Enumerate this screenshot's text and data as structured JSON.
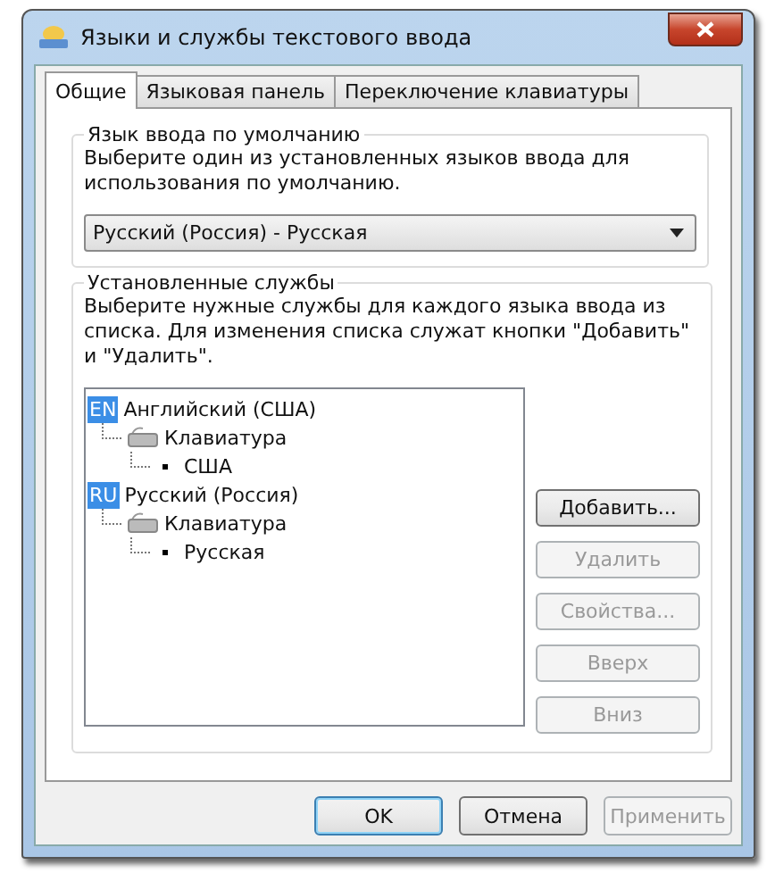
{
  "window": {
    "title": "Языки и службы текстового ввода"
  },
  "tabs": [
    {
      "label": "Общие",
      "selected": true
    },
    {
      "label": "Языковая панель",
      "selected": false
    },
    {
      "label": "Переключение клавиатуры",
      "selected": false
    }
  ],
  "default_language": {
    "title": "Язык ввода по умолчанию",
    "hint": "Выберите один из установленных языков ввода для использования по умолчанию.",
    "value": "Русский (Россия) - Русская"
  },
  "services": {
    "title": "Установленные службы",
    "hint": "Выберите нужные службы для каждого языка ввода из списка. Для изменения списка служат кнопки \"Добавить\" и \"Удалить\".",
    "tree": [
      {
        "kind": "language",
        "badge": "EN",
        "label": "Английский (США)",
        "children": [
          {
            "kind": "category",
            "label": "Клавиатура",
            "children": [
              {
                "kind": "layout",
                "label": "США"
              }
            ]
          }
        ]
      },
      {
        "kind": "language",
        "badge": "RU",
        "label": "Русский (Россия)",
        "children": [
          {
            "kind": "category",
            "label": "Клавиатура",
            "children": [
              {
                "kind": "layout",
                "label": "Русская"
              }
            ]
          }
        ]
      }
    ],
    "buttons": [
      {
        "label": "Добавить...",
        "disabled": false
      },
      {
        "label": "Удалить",
        "disabled": true
      },
      {
        "label": "Свойства...",
        "disabled": true
      },
      {
        "label": "Вверх",
        "disabled": true
      },
      {
        "label": "Вниз",
        "disabled": true
      }
    ]
  },
  "dialog_buttons": [
    {
      "label": "OK",
      "disabled": false,
      "default": true
    },
    {
      "label": "Отмена",
      "disabled": false,
      "default": false
    },
    {
      "label": "Применить",
      "disabled": true,
      "default": false
    }
  ]
}
